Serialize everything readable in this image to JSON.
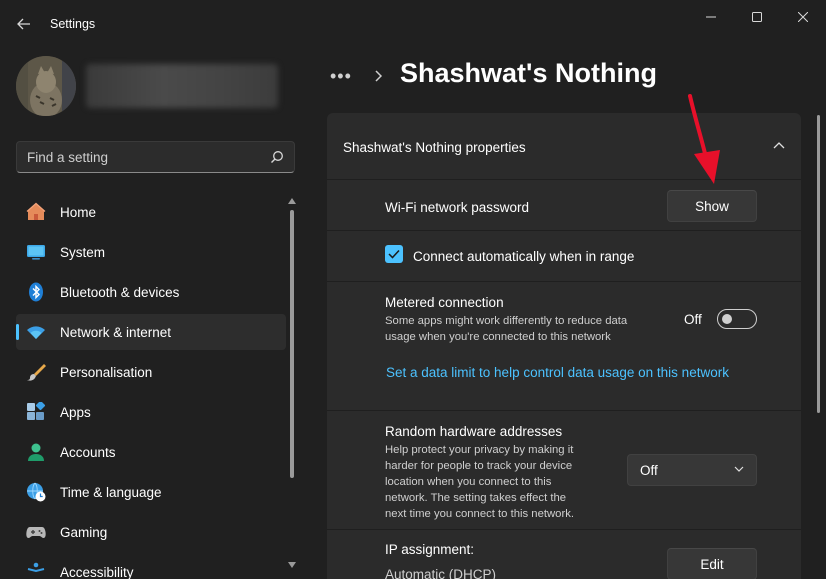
{
  "window": {
    "app_title": "Settings"
  },
  "profile": {
    "name_redacted": ""
  },
  "search": {
    "placeholder": "Find a setting"
  },
  "sidebar": {
    "items": [
      {
        "label": "Home",
        "icon": "home-icon"
      },
      {
        "label": "System",
        "icon": "system-icon"
      },
      {
        "label": "Bluetooth & devices",
        "icon": "bluetooth-icon"
      },
      {
        "label": "Network & internet",
        "icon": "wifi-icon",
        "active": true
      },
      {
        "label": "Personalisation",
        "icon": "brush-icon"
      },
      {
        "label": "Apps",
        "icon": "apps-icon"
      },
      {
        "label": "Accounts",
        "icon": "accounts-icon"
      },
      {
        "label": "Time & language",
        "icon": "globe-clock-icon"
      },
      {
        "label": "Gaming",
        "icon": "gamepad-icon"
      },
      {
        "label": "Accessibility",
        "icon": "accessibility-icon"
      }
    ]
  },
  "breadcrumb": {
    "more": "•••",
    "page_title": "Shashwat's Nothing"
  },
  "properties": {
    "section_title": "Shashwat's Nothing properties",
    "wifi_password": {
      "label": "Wi-Fi network password",
      "button": "Show"
    },
    "connect_auto": {
      "label": "Connect automatically when in range",
      "checked": true
    },
    "metered": {
      "label": "Metered connection",
      "desc_line1": "Some apps might work differently to reduce data",
      "desc_line2": "usage when you're connected to this network",
      "state_label": "Off",
      "link": "Set a data limit to help control data usage on this network"
    },
    "random_hw": {
      "label": "Random hardware addresses",
      "desc_line1": "Help protect your privacy by making it",
      "desc_line2": "harder for people to track your device",
      "desc_line3": "location when you connect to this",
      "desc_line4": "network. The setting takes effect the",
      "desc_line5": "next time you connect to this network.",
      "selected": "Off"
    },
    "ip_assignment": {
      "label": "IP assignment:",
      "value": "Automatic (DHCP)",
      "button": "Edit"
    }
  },
  "colors": {
    "accent": "#4cc2ff",
    "background": "#202020",
    "card": "#2b2b2b",
    "annotation_arrow": "#e8102a"
  }
}
